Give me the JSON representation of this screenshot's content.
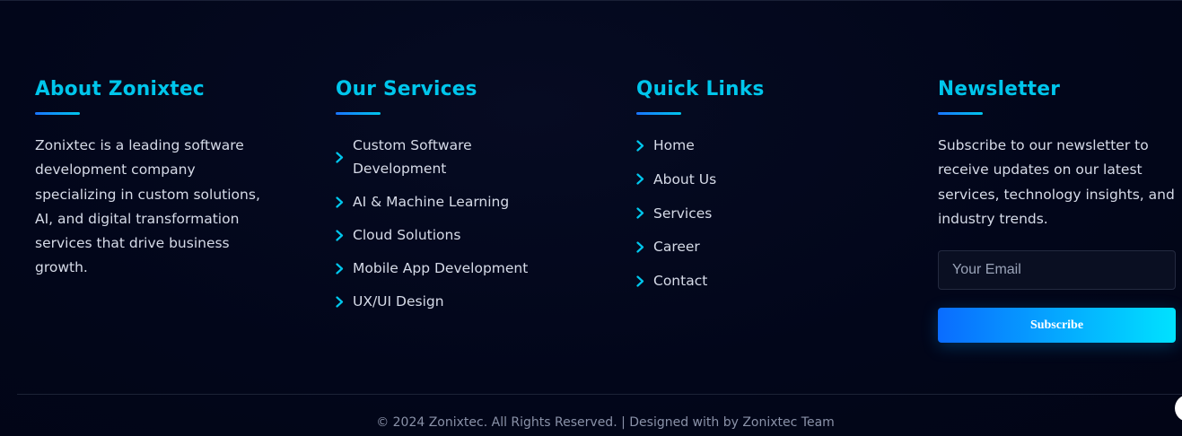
{
  "about": {
    "title": "About Zonixtec",
    "text": "Zonixtec is a leading software development company specializing in custom solutions, AI, and digital transformation services that drive business growth."
  },
  "services": {
    "title": "Our Services",
    "items": [
      {
        "label": "Custom Software Development"
      },
      {
        "label": "AI & Machine Learning"
      },
      {
        "label": "Cloud Solutions"
      },
      {
        "label": "Mobile App Development"
      },
      {
        "label": "UX/UI Design"
      }
    ]
  },
  "quick_links": {
    "title": "Quick Links",
    "items": [
      {
        "label": "Home"
      },
      {
        "label": "About Us"
      },
      {
        "label": "Services"
      },
      {
        "label": "Career"
      },
      {
        "label": "Contact"
      }
    ]
  },
  "newsletter": {
    "title": "Newsletter",
    "text": "Subscribe to our newsletter to receive updates on our latest services, technology insights, and industry trends.",
    "email_placeholder": "Your Email",
    "email_value": "",
    "subscribe_label": "Subscribe"
  },
  "footer_bottom": {
    "copyright": "© 2024 Zonixtec. All Rights Reserved. | Designed with by Zonixtec Team"
  },
  "colors": {
    "accent": "#00c6ec",
    "gradient_start": "#0a6cff",
    "gradient_end": "#00e2ff",
    "background": "#02061a"
  },
  "icons": {
    "list_bullet": "chevron-right-icon"
  }
}
